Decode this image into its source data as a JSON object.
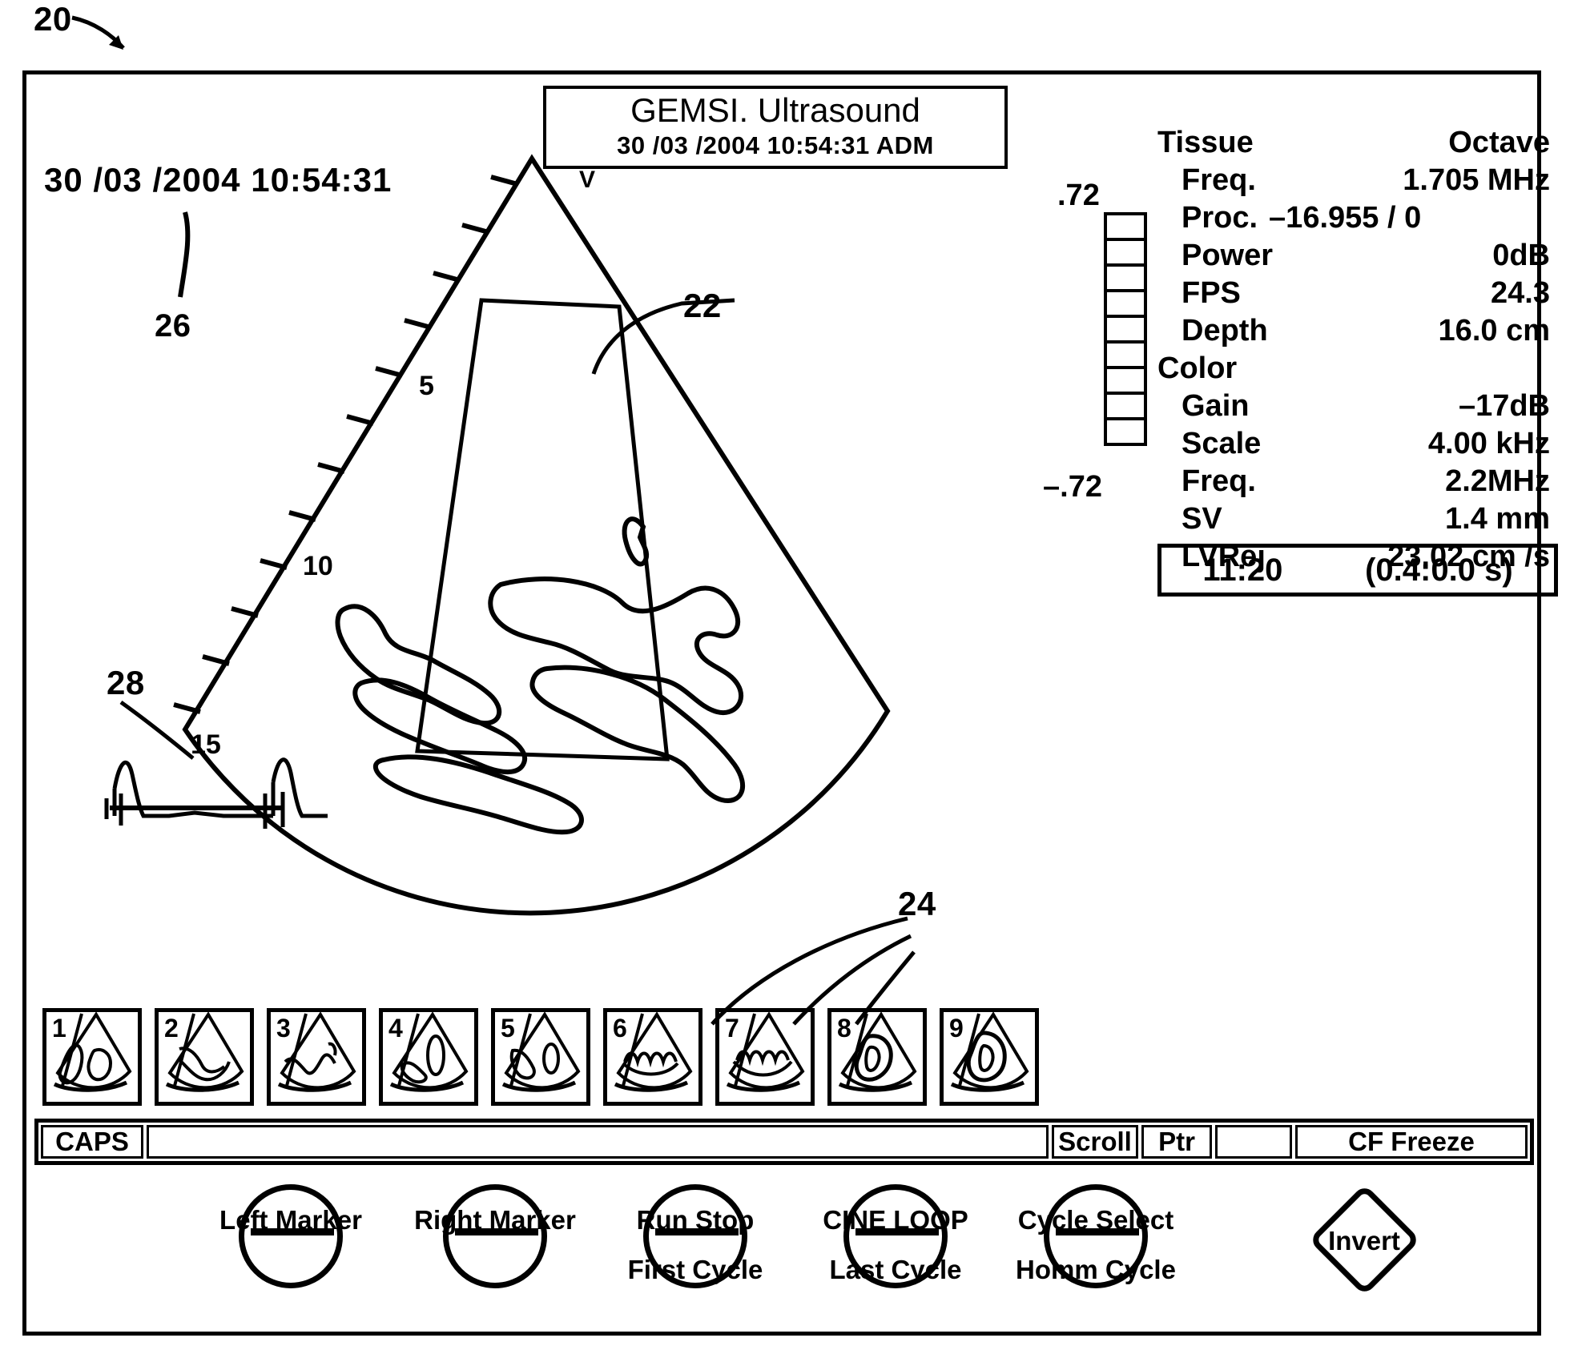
{
  "figure": {
    "ref_main": "20",
    "ref_image": "22",
    "ref_thumbs": "24",
    "ref_stamp": "26",
    "ref_ecg": "28"
  },
  "header": {
    "title": "GEMSI. Ultrasound",
    "subtitle": "30 /03 /2004   10:54:31   ADM"
  },
  "stamp": {
    "text": "30 /03 /2004    10:54:31"
  },
  "sector": {
    "apex_label": "V",
    "depth_ticks": [
      "5",
      "10",
      "15"
    ]
  },
  "colorbar": {
    "top_label": ".72",
    "bottom_label": "–.72",
    "segments": 9
  },
  "params": [
    {
      "key": "Tissue",
      "value": "Octave",
      "indent": false,
      "wide": false
    },
    {
      "key": "Freq.",
      "value": "1.705  MHz",
      "indent": true,
      "wide": false
    },
    {
      "key": "Proc.",
      "value": "–16.955 / 0",
      "indent": true,
      "wide": true
    },
    {
      "key": "Power",
      "value": "0dB",
      "indent": true,
      "wide": false
    },
    {
      "key": "FPS",
      "value": "24.3",
      "indent": true,
      "wide": false
    },
    {
      "key": "Depth",
      "value": "16.0  cm",
      "indent": true,
      "wide": false
    },
    {
      "key": "Color",
      "value": "",
      "indent": false,
      "wide": false
    },
    {
      "key": "Gain",
      "value": "–17dB",
      "indent": true,
      "wide": false
    },
    {
      "key": "Scale",
      "value": "4.00  kHz",
      "indent": true,
      "wide": false
    },
    {
      "key": "Freq.",
      "value": "2.2MHz",
      "indent": true,
      "wide": false
    },
    {
      "key": "SV",
      "value": "1.4  mm",
      "indent": true,
      "wide": false
    },
    {
      "key": "LVRej",
      "value": "23.02  cm  /s",
      "indent": true,
      "wide": false
    }
  ],
  "timer": {
    "clock": "11:20",
    "elapsed": "(0.4:0.0  s)"
  },
  "thumbnails": [
    {
      "n": "1"
    },
    {
      "n": "2"
    },
    {
      "n": "3"
    },
    {
      "n": "4"
    },
    {
      "n": "5"
    },
    {
      "n": "6"
    },
    {
      "n": "7"
    },
    {
      "n": "8"
    },
    {
      "n": "9"
    }
  ],
  "statusbar": {
    "caps": "CAPS",
    "blank": "",
    "scroll": "Scroll",
    "ptr": "Ptr",
    "empty": "",
    "cf_freeze": "CF  Freeze"
  },
  "knobs": [
    {
      "top": "Left Marker",
      "bottom": "",
      "type": "dial"
    },
    {
      "top": "Right Marker",
      "bottom": "",
      "type": "dial"
    },
    {
      "top": "Run  Stop",
      "bottom": "First Cycle",
      "type": "split"
    },
    {
      "top": "CINE  LOOP",
      "bottom": "Last Cycle",
      "type": "split"
    },
    {
      "top": "Cycle Select",
      "bottom": "Homm  Cycle",
      "type": "split"
    },
    {
      "top": "Invert",
      "bottom": "",
      "type": "diamond"
    }
  ]
}
